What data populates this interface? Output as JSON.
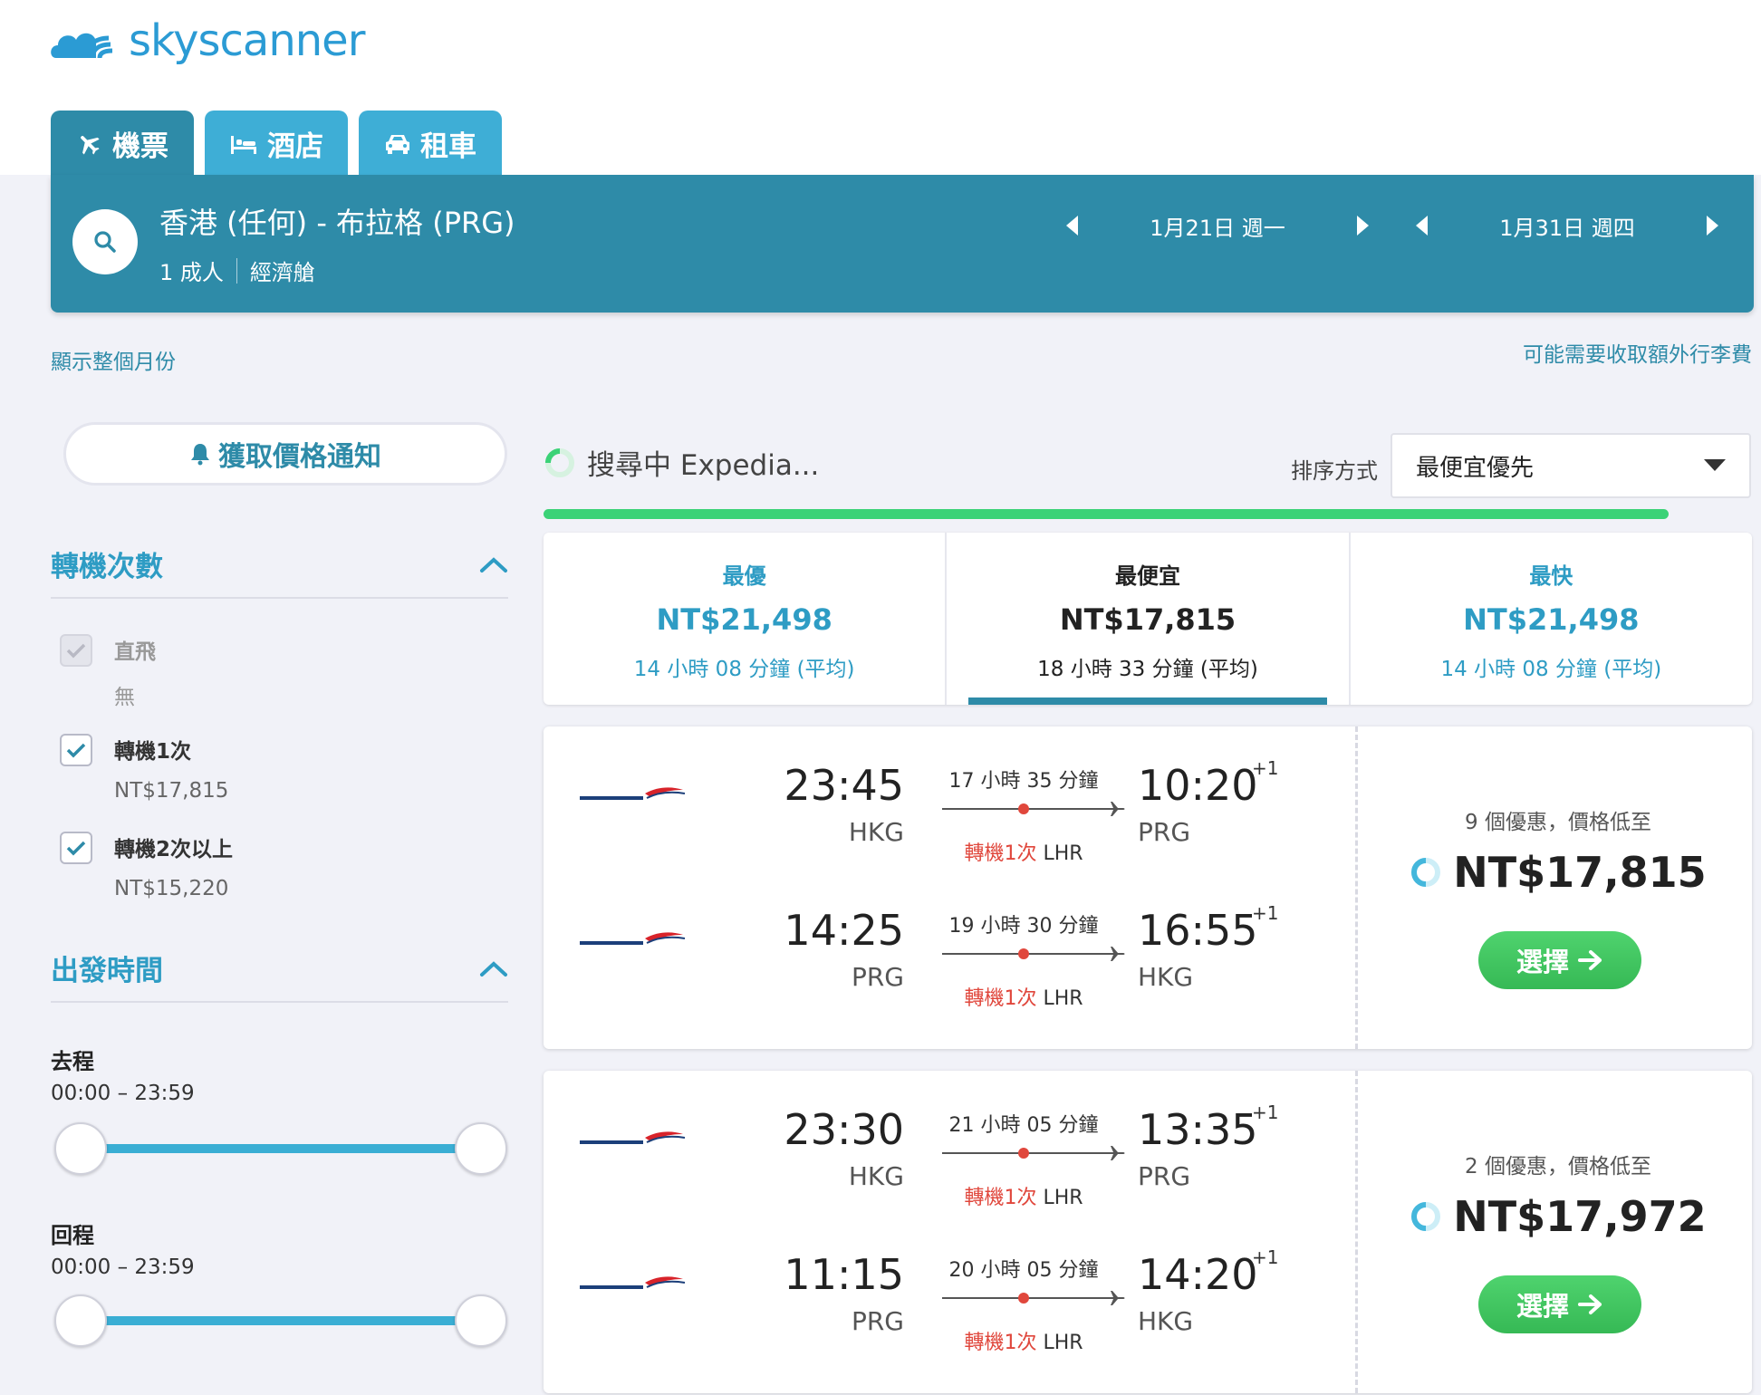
{
  "brand": {
    "name": "skyscanner"
  },
  "tabs": [
    {
      "label": "機票",
      "icon": "plane-icon"
    },
    {
      "label": "酒店",
      "icon": "bed-icon"
    },
    {
      "label": "租車",
      "icon": "car-icon"
    }
  ],
  "search": {
    "route": "香港 (任何) - 布拉格 (PRG)",
    "passengers": "1 成人",
    "cabin": "經濟艙",
    "depart_date": "1月21日 週一",
    "return_date": "1月31日 週四"
  },
  "links": {
    "whole_month": "顯示整個月份",
    "baggage_fee": "可能需要收取額外行李費"
  },
  "price_alert": {
    "label": "獲取價格通知"
  },
  "filters": {
    "stops": {
      "title": "轉機次數",
      "options": [
        {
          "label": "直飛",
          "sub": "無",
          "checked": false,
          "disabled": true
        },
        {
          "label": "轉機1次",
          "sub": "NT$17,815",
          "checked": true
        },
        {
          "label": "轉機2次以上",
          "sub": "NT$15,220",
          "checked": true
        }
      ]
    },
    "times": {
      "title": "出發時間",
      "outbound_label": "去程",
      "outbound_range": "00:00 – 23:59",
      "return_label": "回程",
      "return_range": "00:00 – 23:59"
    }
  },
  "status": {
    "text": "搜尋中 Expedia..."
  },
  "sort": {
    "label": "排序方式",
    "value": "最便宜優先"
  },
  "summary": [
    {
      "title": "最優",
      "price": "NT$21,498",
      "duration": "14 小時 08 分鐘 (平均)"
    },
    {
      "title": "最便宜",
      "price": "NT$17,815",
      "duration": "18 小時 33 分鐘 (平均)"
    },
    {
      "title": "最快",
      "price": "NT$21,498",
      "duration": "14 小時 08 分鐘 (平均)"
    }
  ],
  "results": [
    {
      "legs": [
        {
          "dep_time": "23:45",
          "dep_code": "HKG",
          "duration": "17 小時 35 分鐘",
          "stops": "轉機1次",
          "via": "LHR",
          "arr_time": "10:20",
          "plus": "+1",
          "arr_code": "PRG"
        },
        {
          "dep_time": "14:25",
          "dep_code": "PRG",
          "duration": "19 小時 30 分鐘",
          "stops": "轉機1次",
          "via": "LHR",
          "arr_time": "16:55",
          "plus": "+1",
          "arr_code": "HKG"
        }
      ],
      "deals": "9 個優惠，價格低至",
      "price": "NT$17,815",
      "select": "選擇"
    },
    {
      "legs": [
        {
          "dep_time": "23:30",
          "dep_code": "HKG",
          "duration": "21 小時 05 分鐘",
          "stops": "轉機1次",
          "via": "LHR",
          "arr_time": "13:35",
          "plus": "+1",
          "arr_code": "PRG"
        },
        {
          "dep_time": "11:15",
          "dep_code": "PRG",
          "duration": "20 小時 05 分鐘",
          "stops": "轉機1次",
          "via": "LHR",
          "arr_time": "14:20",
          "plus": "+1",
          "arr_code": "HKG"
        }
      ],
      "deals": "2 個優惠，價格低至",
      "price": "NT$17,972",
      "select": "選擇"
    }
  ],
  "colors": {
    "brand_teal": "#2e8ba8",
    "tab_light": "#3eaed6",
    "accent_green": "#3cc45e",
    "stop_red": "#e0473c"
  }
}
